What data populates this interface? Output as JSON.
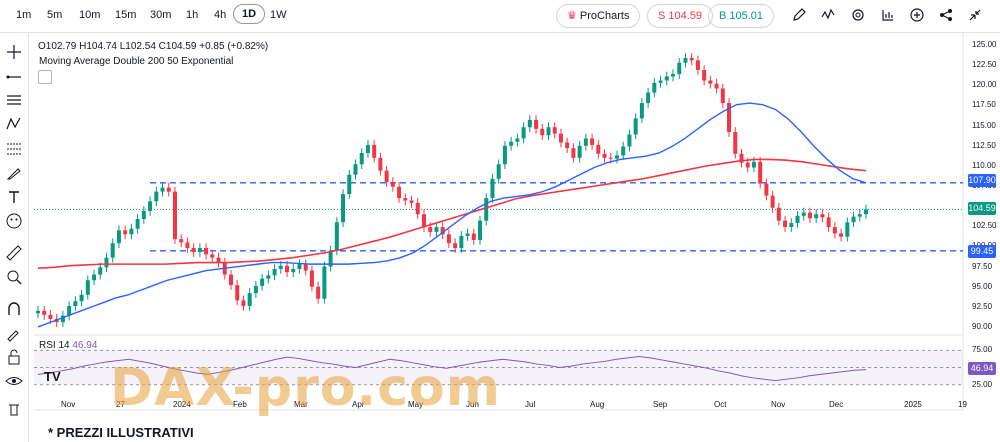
{
  "toolbar": {
    "timeframes": [
      "1m",
      "5m",
      "10m",
      "15m",
      "30m",
      "1h",
      "4h",
      "1D",
      "1W"
    ],
    "active_timeframe": "1D",
    "prochart_label": "ProCharts",
    "sell_label": "S 104.59",
    "buy_label": "B 105.01",
    "icons": [
      "pencil-icon",
      "indicators-icon",
      "settings-icon",
      "layout-icon",
      "add-icon",
      "share-icon",
      "collapse-icon"
    ]
  },
  "legend": {
    "ohlc": "O102.79 H104.74 L102.54 C104.59 +0.85 (+0.82%)",
    "indicator": "Moving Average Double 200 50 Exponential",
    "rsi_name": "RSI 14",
    "rsi_value": "46.94"
  },
  "price_axis": {
    "ticks": [
      "125.00",
      "122.50",
      "120.00",
      "117.50",
      "115.00",
      "112.50",
      "110.00",
      "107.50",
      "105.00",
      "102.50",
      "100.00",
      "97.50",
      "95.00",
      "92.50",
      "90.00"
    ],
    "level_upper": "107.90",
    "current": "104.59",
    "level_lower": "99.45"
  },
  "rsi_axis": {
    "ticks": [
      "75.00",
      "50.00",
      "25.00"
    ],
    "current": "46.94"
  },
  "time_axis": {
    "labels": [
      "Nov",
      "27",
      "2024",
      "Feb",
      "Mar",
      "Apr",
      "May",
      "Jun",
      "Jul",
      "Aug",
      "Sep",
      "Oct",
      "Nov",
      "Dec",
      "2025",
      "19"
    ]
  },
  "colors": {
    "up": "#089981",
    "down": "#f23645",
    "ema50": "#2962ff",
    "ema200": "#f23645",
    "level": "#2962ff",
    "rsi": "#7e57c2"
  },
  "watermark": "DAX-pro.com",
  "footer": "* PREZZI ILLUSTRATIVI",
  "chart_data": {
    "type": "candlestick",
    "levels": [
      107.9,
      99.45
    ],
    "ylim": [
      89,
      126
    ],
    "closes": [
      92.0,
      91.5,
      91.0,
      90.6,
      91.4,
      92.6,
      93.2,
      94.0,
      95.8,
      96.5,
      97.4,
      98.6,
      100.4,
      102.0,
      101.5,
      102.2,
      103.4,
      104.4,
      105.6,
      106.8,
      107.3,
      106.8,
      100.9,
      100.5,
      99.8,
      99.3,
      99.8,
      99.0,
      98.6,
      98.0,
      96.5,
      95.2,
      93.3,
      92.6,
      94.2,
      95.1,
      96.0,
      96.4,
      97.2,
      97.6,
      96.8,
      97.2,
      97.8,
      97.0,
      95.0,
      93.5,
      97.5,
      99.5,
      103.0,
      106.5,
      108.9,
      110.2,
      111.6,
      112.6,
      111.0,
      109.4,
      108.0,
      107.4,
      106.0,
      105.7,
      105.4,
      104.0,
      102.4,
      101.8,
      102.4,
      101.5,
      100.4,
      99.8,
      101.3,
      101.6,
      100.8,
      103.2,
      106.0,
      108.4,
      110.2,
      112.5,
      113.0,
      113.4,
      114.8,
      115.7,
      114.6,
      113.8,
      114.8,
      114.0,
      112.9,
      112.2,
      111.0,
      112.5,
      113.4,
      112.6,
      111.5,
      111.0,
      110.9,
      111.3,
      112.4,
      113.9,
      115.9,
      117.8,
      119.1,
      120.3,
      120.6,
      121.1,
      121.4,
      122.8,
      123.4,
      123.1,
      121.9,
      120.6,
      120.2,
      119.6,
      117.8,
      114.2,
      111.5,
      110.4,
      109.8,
      110.5,
      107.8,
      106.3,
      104.8,
      103.2,
      102.4,
      102.9,
      103.8,
      104.2,
      103.5,
      104.0,
      103.6,
      102.4,
      101.6,
      101.2,
      103.0,
      103.7,
      104.0,
      104.59
    ],
    "ema50": [
      90.0,
      90.6,
      91.2,
      91.8,
      92.4,
      93.0,
      93.6,
      94.0,
      94.6,
      95.2,
      95.8,
      96.2,
      96.6,
      97.0,
      97.2,
      97.4,
      97.6,
      97.8,
      98.0,
      98.0,
      97.9,
      97.8,
      97.8,
      97.8,
      97.8,
      97.9,
      98.0,
      98.2,
      98.6,
      99.2,
      100.2,
      101.4,
      102.6,
      103.8,
      104.8,
      105.6,
      106.0,
      106.2,
      106.4,
      106.8,
      107.4,
      108.2,
      109.0,
      109.8,
      110.4,
      110.8,
      111.0,
      111.2,
      111.6,
      112.4,
      113.4,
      114.6,
      115.8,
      116.8,
      117.6,
      117.8,
      117.6,
      117.0,
      115.8,
      114.2,
      112.4,
      110.8,
      109.4,
      108.4,
      107.9
    ],
    "ema200": [
      97.3,
      97.4,
      97.6,
      97.7,
      97.8,
      97.8,
      97.8,
      97.8,
      97.8,
      97.9,
      98.0,
      98.0,
      98.0,
      98.1,
      98.2,
      98.4,
      98.6,
      98.9,
      99.2,
      99.6,
      100.1,
      100.6,
      101.1,
      101.7,
      102.3,
      102.9,
      103.5,
      104.1,
      104.7,
      105.3,
      105.9,
      106.3,
      106.6,
      106.9,
      107.2,
      107.5,
      107.8,
      108.1,
      108.4,
      108.8,
      109.2,
      109.6,
      110.0,
      110.3,
      110.6,
      110.8,
      110.8,
      110.7,
      110.5,
      110.2,
      109.9,
      109.6,
      109.4
    ],
    "rsi": [
      40,
      42,
      45,
      48,
      52,
      55,
      58,
      60,
      62,
      59,
      56,
      52,
      48,
      45,
      42,
      40,
      43,
      46,
      50,
      54,
      58,
      62,
      65,
      63,
      60,
      57,
      55,
      52,
      50,
      54,
      58,
      62,
      60,
      57,
      54,
      51,
      49,
      52,
      55,
      58,
      60,
      62,
      60,
      58,
      55,
      53,
      50,
      52,
      55,
      57,
      59,
      62,
      64,
      66,
      64,
      61,
      58,
      55,
      52,
      49,
      45,
      42,
      38,
      35,
      33,
      31,
      33,
      35,
      38,
      40,
      42,
      44,
      46,
      46.94
    ]
  }
}
